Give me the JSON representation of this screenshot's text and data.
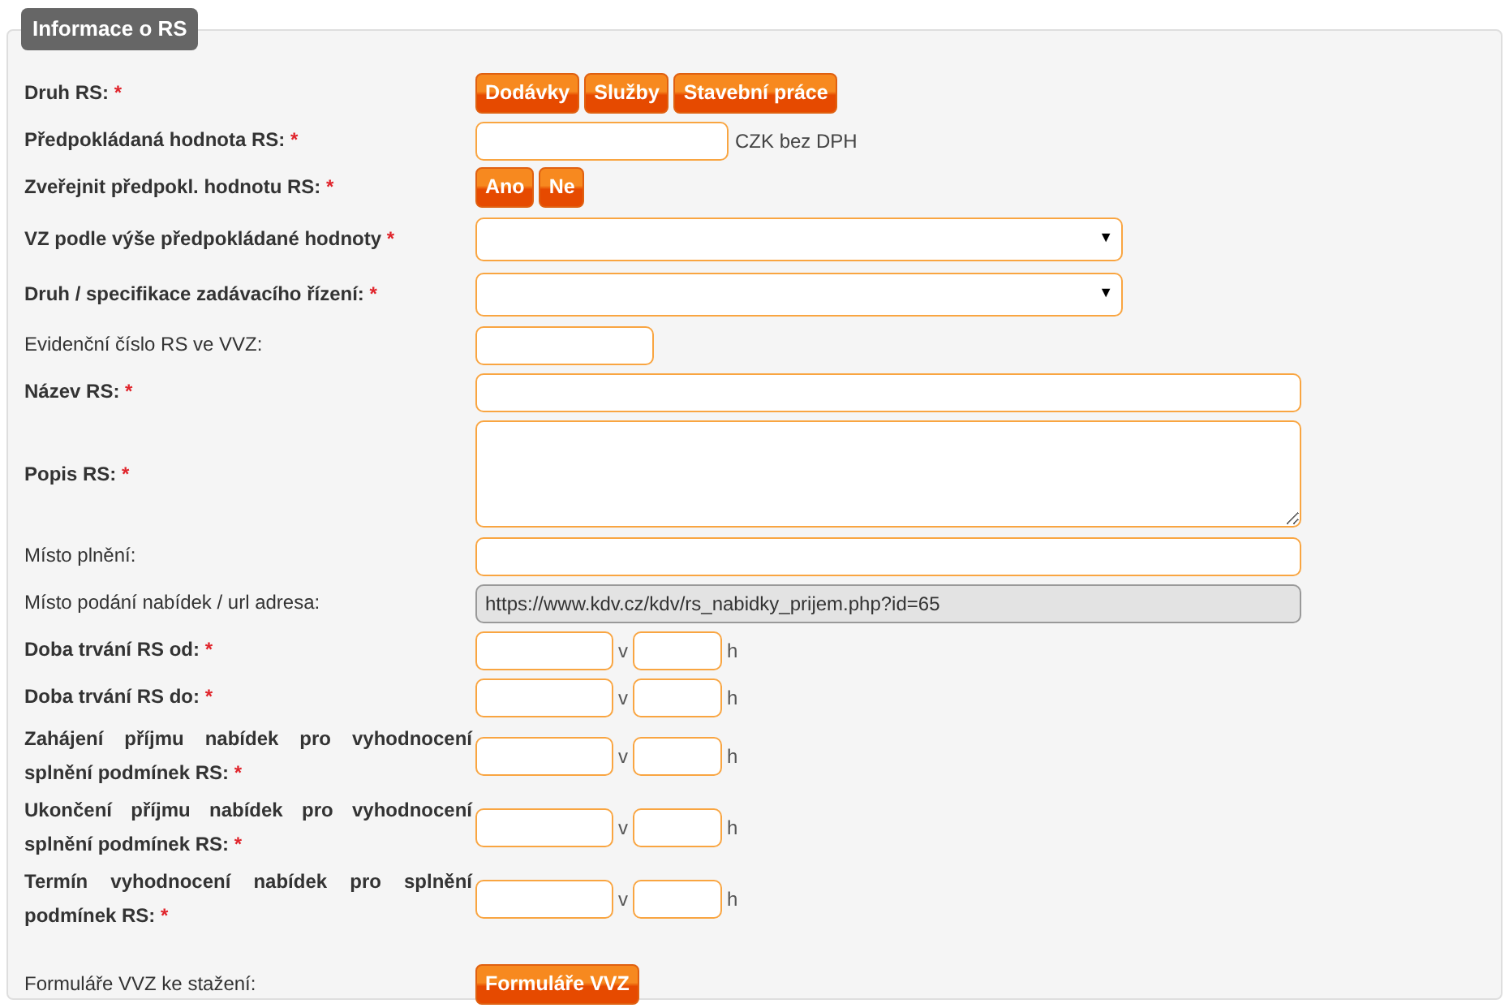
{
  "legend": "Informace o RS",
  "rows": [
    {
      "kind": "buttons",
      "label": "Druh RS:",
      "bold": true,
      "required": "*",
      "buttons": [
        "Dodávky",
        "Služby",
        "Stavební práce"
      ]
    },
    {
      "kind": "medium-input",
      "label": "Předpokládaná hodnota RS:",
      "bold": true,
      "required": "*",
      "suffix": "CZK bez DPH"
    },
    {
      "kind": "buttons",
      "label": "Zveřejnit předpokl. hodnotu RS:",
      "bold": true,
      "required": "*",
      "buttons": [
        "Ano",
        "Ne"
      ]
    },
    {
      "kind": "select",
      "label": "VZ podle výše předpokládané hodnoty",
      "bold": true,
      "required": "*",
      "arrow": "▼"
    },
    {
      "kind": "select",
      "label": "Druh / specifikace zadávacího řízení:",
      "bold": true,
      "required": "*",
      "arrow": "▼"
    },
    {
      "kind": "short-input",
      "label": "Evidenční číslo RS ve VVZ:",
      "bold": false
    },
    {
      "kind": "wide-input",
      "label": "Název RS:",
      "bold": true,
      "required": "*"
    },
    {
      "kind": "textarea",
      "label": "Popis RS:",
      "bold": true,
      "required": "*"
    },
    {
      "kind": "wide-input",
      "label": "Místo plnění:",
      "bold": false
    },
    {
      "kind": "readonly",
      "label": "Místo podání nabídek / url adresa:",
      "bold": false,
      "value": "https://www.kdv.cz/kdv/rs_nabidky_prijem.php?id=65"
    },
    {
      "kind": "datetime",
      "label": "Doba trvání RS od:",
      "bold": true,
      "required": "*",
      "sep": "v",
      "unit": "h"
    },
    {
      "kind": "datetime",
      "label": "Doba trvání RS do:",
      "bold": true,
      "required": "*",
      "sep": "v",
      "unit": "h"
    },
    {
      "kind": "datetime",
      "label": "Zahájení příjmu nabídek pro vyhodnocení splnění podmínek RS:",
      "bold": true,
      "required": "*",
      "sep": "v",
      "unit": "h"
    },
    {
      "kind": "datetime",
      "label": "Ukončení příjmu nabídek pro vyhodnocení splnění podmínek RS:",
      "bold": true,
      "required": "*",
      "sep": "v",
      "unit": "h"
    },
    {
      "kind": "datetime",
      "label": "Termín vyhodnocení nabídek pro splnění podmínek RS:",
      "bold": true,
      "required": "*",
      "sep": "v",
      "unit": "h"
    },
    {
      "kind": "buttons",
      "label": "Formuláře VVZ ke stažení:",
      "bold": false,
      "buttons": [
        "Formuláře VVZ"
      ]
    }
  ]
}
